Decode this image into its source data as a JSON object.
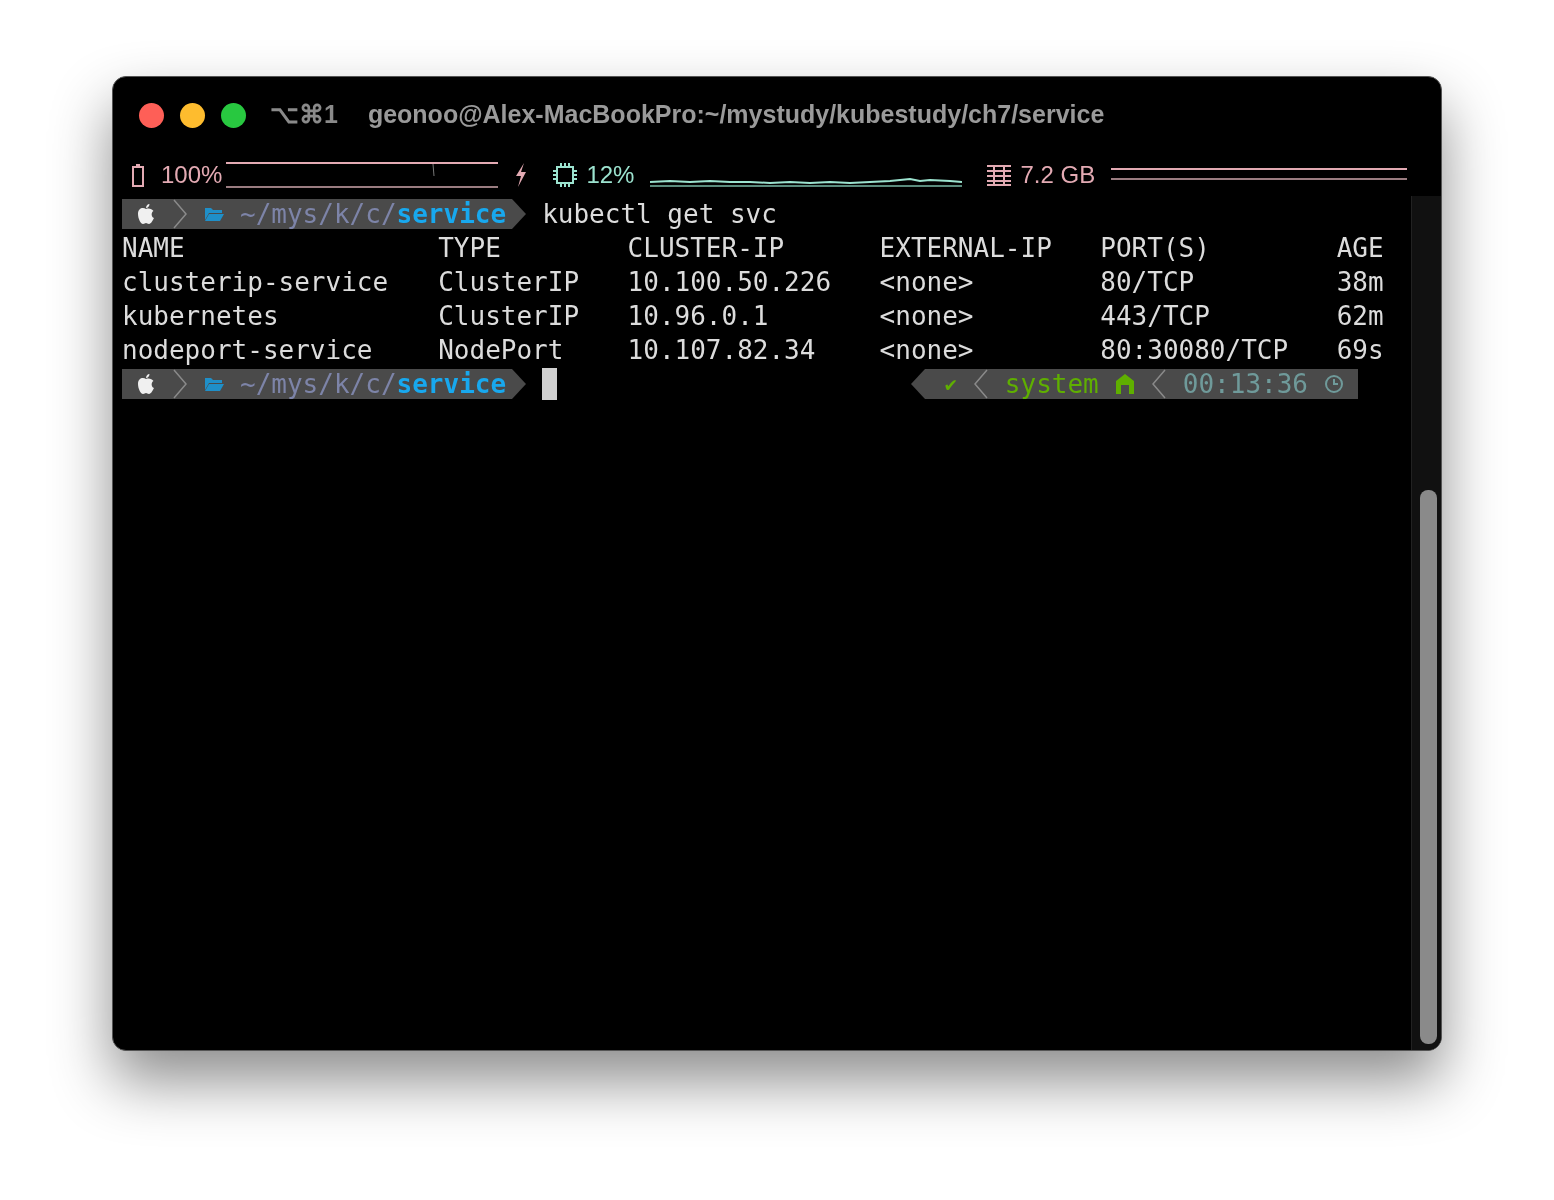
{
  "window": {
    "shortcut": "⌥⌘1",
    "title": "geonoo@Alex-MacBookPro:~/mystudy/kubestudy/ch7/service"
  },
  "status_bar": {
    "battery": "100%",
    "cpu": "12%",
    "memory": "7.2 GB"
  },
  "terminal": {
    "prompt": {
      "path_prefix": "~/mys/k/c/",
      "path_current": "service"
    },
    "command": "kubectl get svc",
    "table": {
      "columns": [
        "NAME",
        "TYPE",
        "CLUSTER-IP",
        "EXTERNAL-IP",
        "PORT(S)",
        "AGE"
      ],
      "rows": [
        [
          "clusterip-service",
          "ClusterIP",
          "10.100.50.226",
          "<none>",
          "80/TCP",
          "38m"
        ],
        [
          "kubernetes",
          "ClusterIP",
          "10.96.0.1",
          "<none>",
          "443/TCP",
          "62m"
        ],
        [
          "nodeport-service",
          "NodePort",
          "10.107.82.34",
          "<none>",
          "80:30080/TCP",
          "69s"
        ]
      ]
    },
    "prompt2": {
      "path_prefix": "~/mys/k/c/",
      "path_current": "service"
    },
    "right_prompt": {
      "status": "✔",
      "context": "system",
      "time": "00:13:36"
    }
  }
}
